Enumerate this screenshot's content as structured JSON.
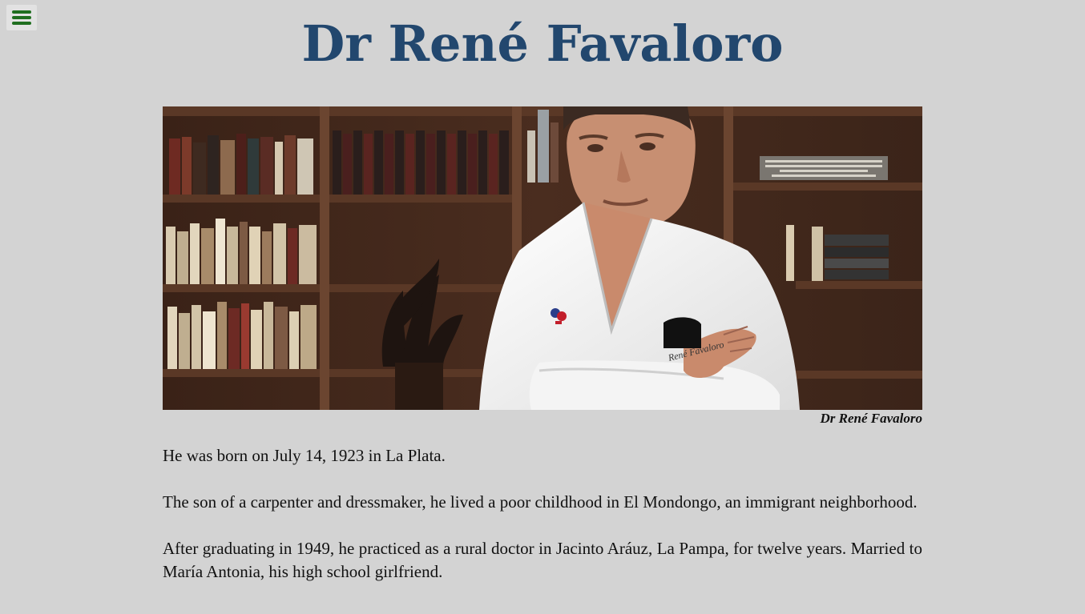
{
  "menu": {
    "icon": "hamburger-menu-icon"
  },
  "header": {
    "title": "Dr René Favaloro"
  },
  "figure": {
    "caption": "Dr René Favaloro",
    "coat_text": "René Favaloro"
  },
  "paragraphs": [
    "He was born on July 14, 1923 in La Plata.",
    "The son of a carpenter and dressmaker, he lived a poor childhood in El Mondongo, an immigrant neighborhood.",
    "After graduating in 1949, he practiced as a rural doctor in Jacinto Aráuz, La Pampa, for twelve years. Married to María Antonia, his high school girlfriend."
  ],
  "colors": {
    "background": "#d3d3d3",
    "title": "#22476e",
    "menu_icon": "#1f6e1f"
  }
}
